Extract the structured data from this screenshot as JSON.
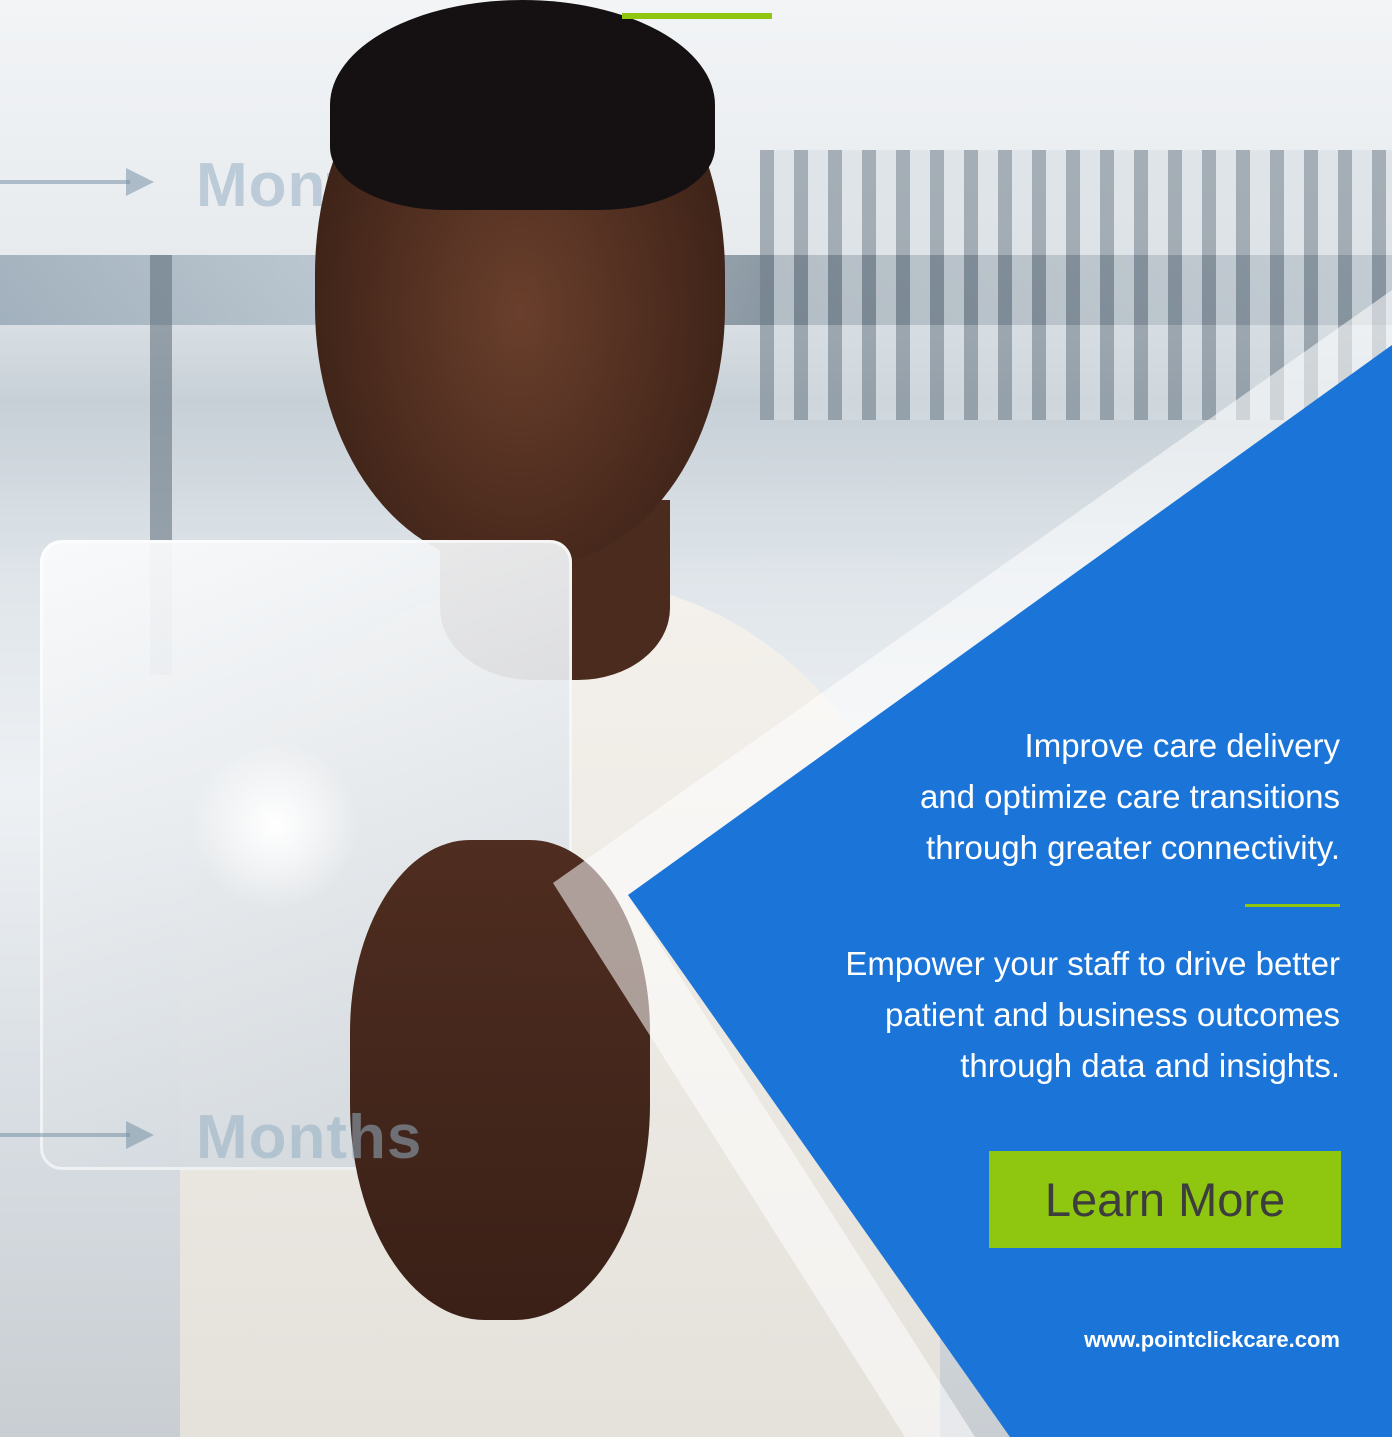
{
  "hero": {
    "ghost_label_top": "Months",
    "ghost_label_bottom": "Months"
  },
  "content": {
    "paragraph_1": "Improve care delivery\nand optimize care transitions\nthrough greater connectivity.",
    "paragraph_2": "Empower your staff to drive better\npatient and business outcomes\nthrough data and insights.",
    "cta_label": "Learn More",
    "website": "www.pointclickcare.com"
  },
  "colors": {
    "panel_blue": "#1b75d8",
    "accent_green": "#8fc60f",
    "cta_text": "#3d3d3d"
  }
}
